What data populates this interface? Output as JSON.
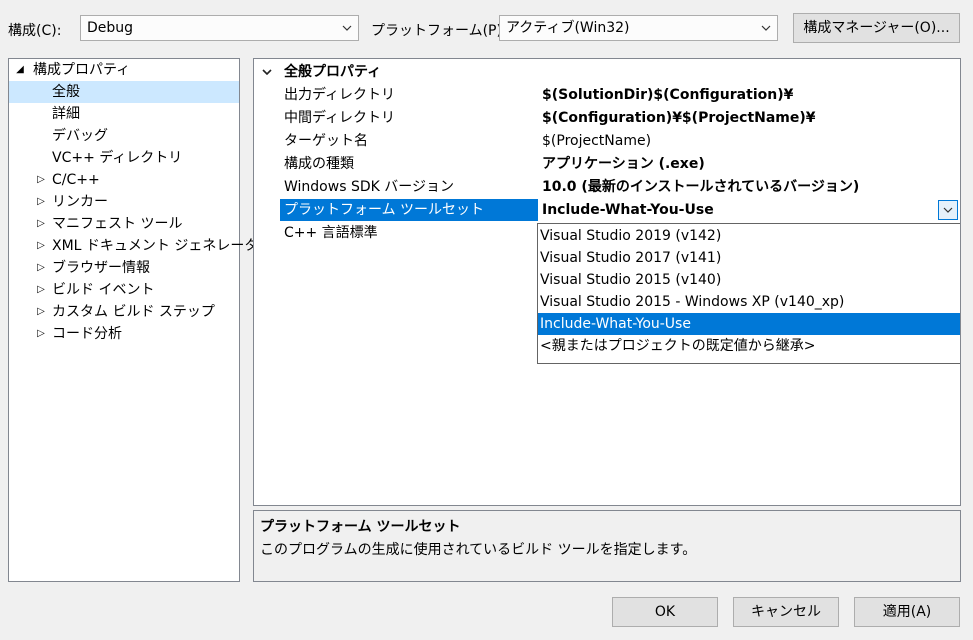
{
  "config": {
    "label": "構成(C):",
    "value": "Debug"
  },
  "platform": {
    "label": "プラットフォーム(P):",
    "value": "アクティブ(Win32)"
  },
  "config_manager_button": "構成マネージャー(O)...",
  "tree": {
    "root": "構成プロパティ",
    "items": [
      {
        "label": "全般"
      },
      {
        "label": "詳細"
      },
      {
        "label": "デバッグ"
      },
      {
        "label": "VC++ ディレクトリ"
      },
      {
        "label": "C/C++"
      },
      {
        "label": "リンカー"
      },
      {
        "label": "マニフェスト ツール"
      },
      {
        "label": "XML ドキュメント ジェネレーター"
      },
      {
        "label": "ブラウザー情報"
      },
      {
        "label": "ビルド イベント"
      },
      {
        "label": "カスタム ビルド ステップ"
      },
      {
        "label": "コード分析"
      }
    ]
  },
  "grid": {
    "category": "全般プロパティ",
    "rows": [
      {
        "name": "出力ディレクトリ",
        "value": "$(SolutionDir)$(Configuration)¥"
      },
      {
        "name": "中間ディレクトリ",
        "value": "$(Configuration)¥$(ProjectName)¥"
      },
      {
        "name": "ターゲット名",
        "value": "$(ProjectName)"
      },
      {
        "name": "構成の種類",
        "value": "アプリケーション (.exe)"
      },
      {
        "name": "Windows SDK バージョン",
        "value": "10.0 (最新のインストールされているバージョン)"
      },
      {
        "name": "プラットフォーム ツールセット",
        "value": "Include-What-You-Use"
      },
      {
        "name": "C++ 言語標準",
        "value": ""
      }
    ]
  },
  "dropdown": {
    "options": [
      "Visual Studio 2019 (v142)",
      "Visual Studio 2017 (v141)",
      "Visual Studio 2015 (v140)",
      "Visual Studio 2015 - Windows XP (v140_xp)",
      "Include-What-You-Use",
      "<親またはプロジェクトの既定値から継承>"
    ],
    "selected_index": 4
  },
  "description": {
    "title": "プラットフォーム ツールセット",
    "text": "このプログラムの生成に使用されているビルド ツールを指定します。"
  },
  "buttons": {
    "ok": "OK",
    "cancel": "キャンセル",
    "apply": "適用(A)"
  },
  "colors": {
    "accent": "#0078d7",
    "tree_selection": "#cce8ff",
    "window_bg": "#f0f0f0"
  },
  "icons": {
    "collapse": "triangle-down-icon",
    "expand": "triangle-right-icon",
    "dropdown": "chevron-down-icon"
  }
}
